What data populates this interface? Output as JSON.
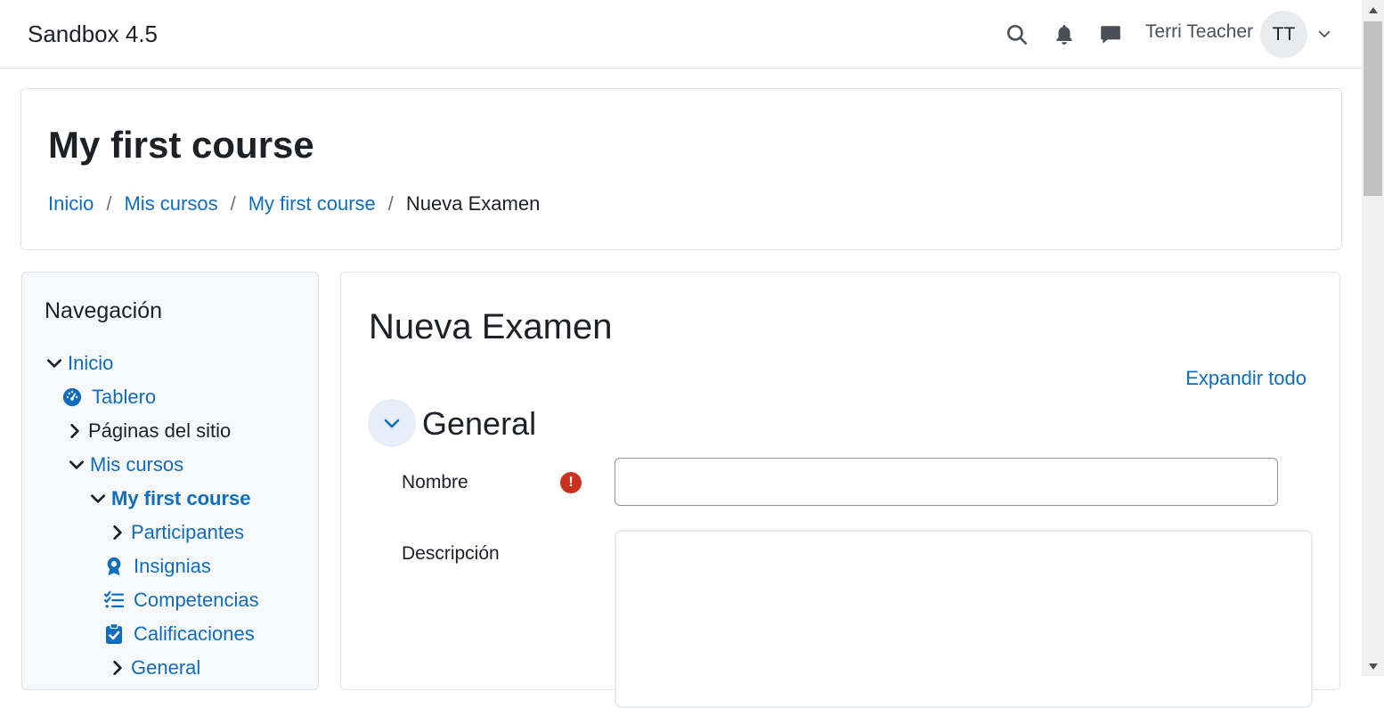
{
  "navbar": {
    "brand": "Sandbox 4.5",
    "user_name": "Terri Teacher",
    "avatar_initials": "TT",
    "icons": [
      "search-icon",
      "bell-icon",
      "message-icon",
      "chevron-down-icon"
    ]
  },
  "header": {
    "course_title": "My first course",
    "breadcrumb": [
      {
        "label": "Inicio"
      },
      {
        "label": "Mis cursos"
      },
      {
        "label": "My first course"
      },
      {
        "label": "Nueva Examen"
      }
    ],
    "separator": "/"
  },
  "navigation": {
    "title": "Navegación",
    "items": [
      {
        "label": "Inicio",
        "icon": "chevron-down-icon"
      },
      {
        "label": "Tablero",
        "icon": "dashboard-icon"
      },
      {
        "label": "Páginas del sitio",
        "icon": "chevron-right-icon"
      },
      {
        "label": "Mis cursos",
        "icon": "chevron-down-icon"
      },
      {
        "label": "My first course",
        "icon": "chevron-down-icon"
      },
      {
        "label": "Participantes",
        "icon": "chevron-right-icon"
      },
      {
        "label": "Insignias",
        "icon": "badge-icon"
      },
      {
        "label": "Competencias",
        "icon": "checklist-icon"
      },
      {
        "label": "Calificaciones",
        "icon": "clipboard-check-icon"
      },
      {
        "label": "General",
        "icon": "chevron-right-icon"
      }
    ]
  },
  "main": {
    "heading": "Nueva Examen",
    "expand_all": "Expandir todo",
    "section_title": "General",
    "fields": {
      "name_label": "Nombre",
      "name_value": "",
      "required_symbol": "!",
      "description_label": "Descripción"
    }
  },
  "colors": {
    "link": "#0f6cbf",
    "text": "#1d2125",
    "required": "#ca3120",
    "nav_background": "#f8f9fa"
  }
}
